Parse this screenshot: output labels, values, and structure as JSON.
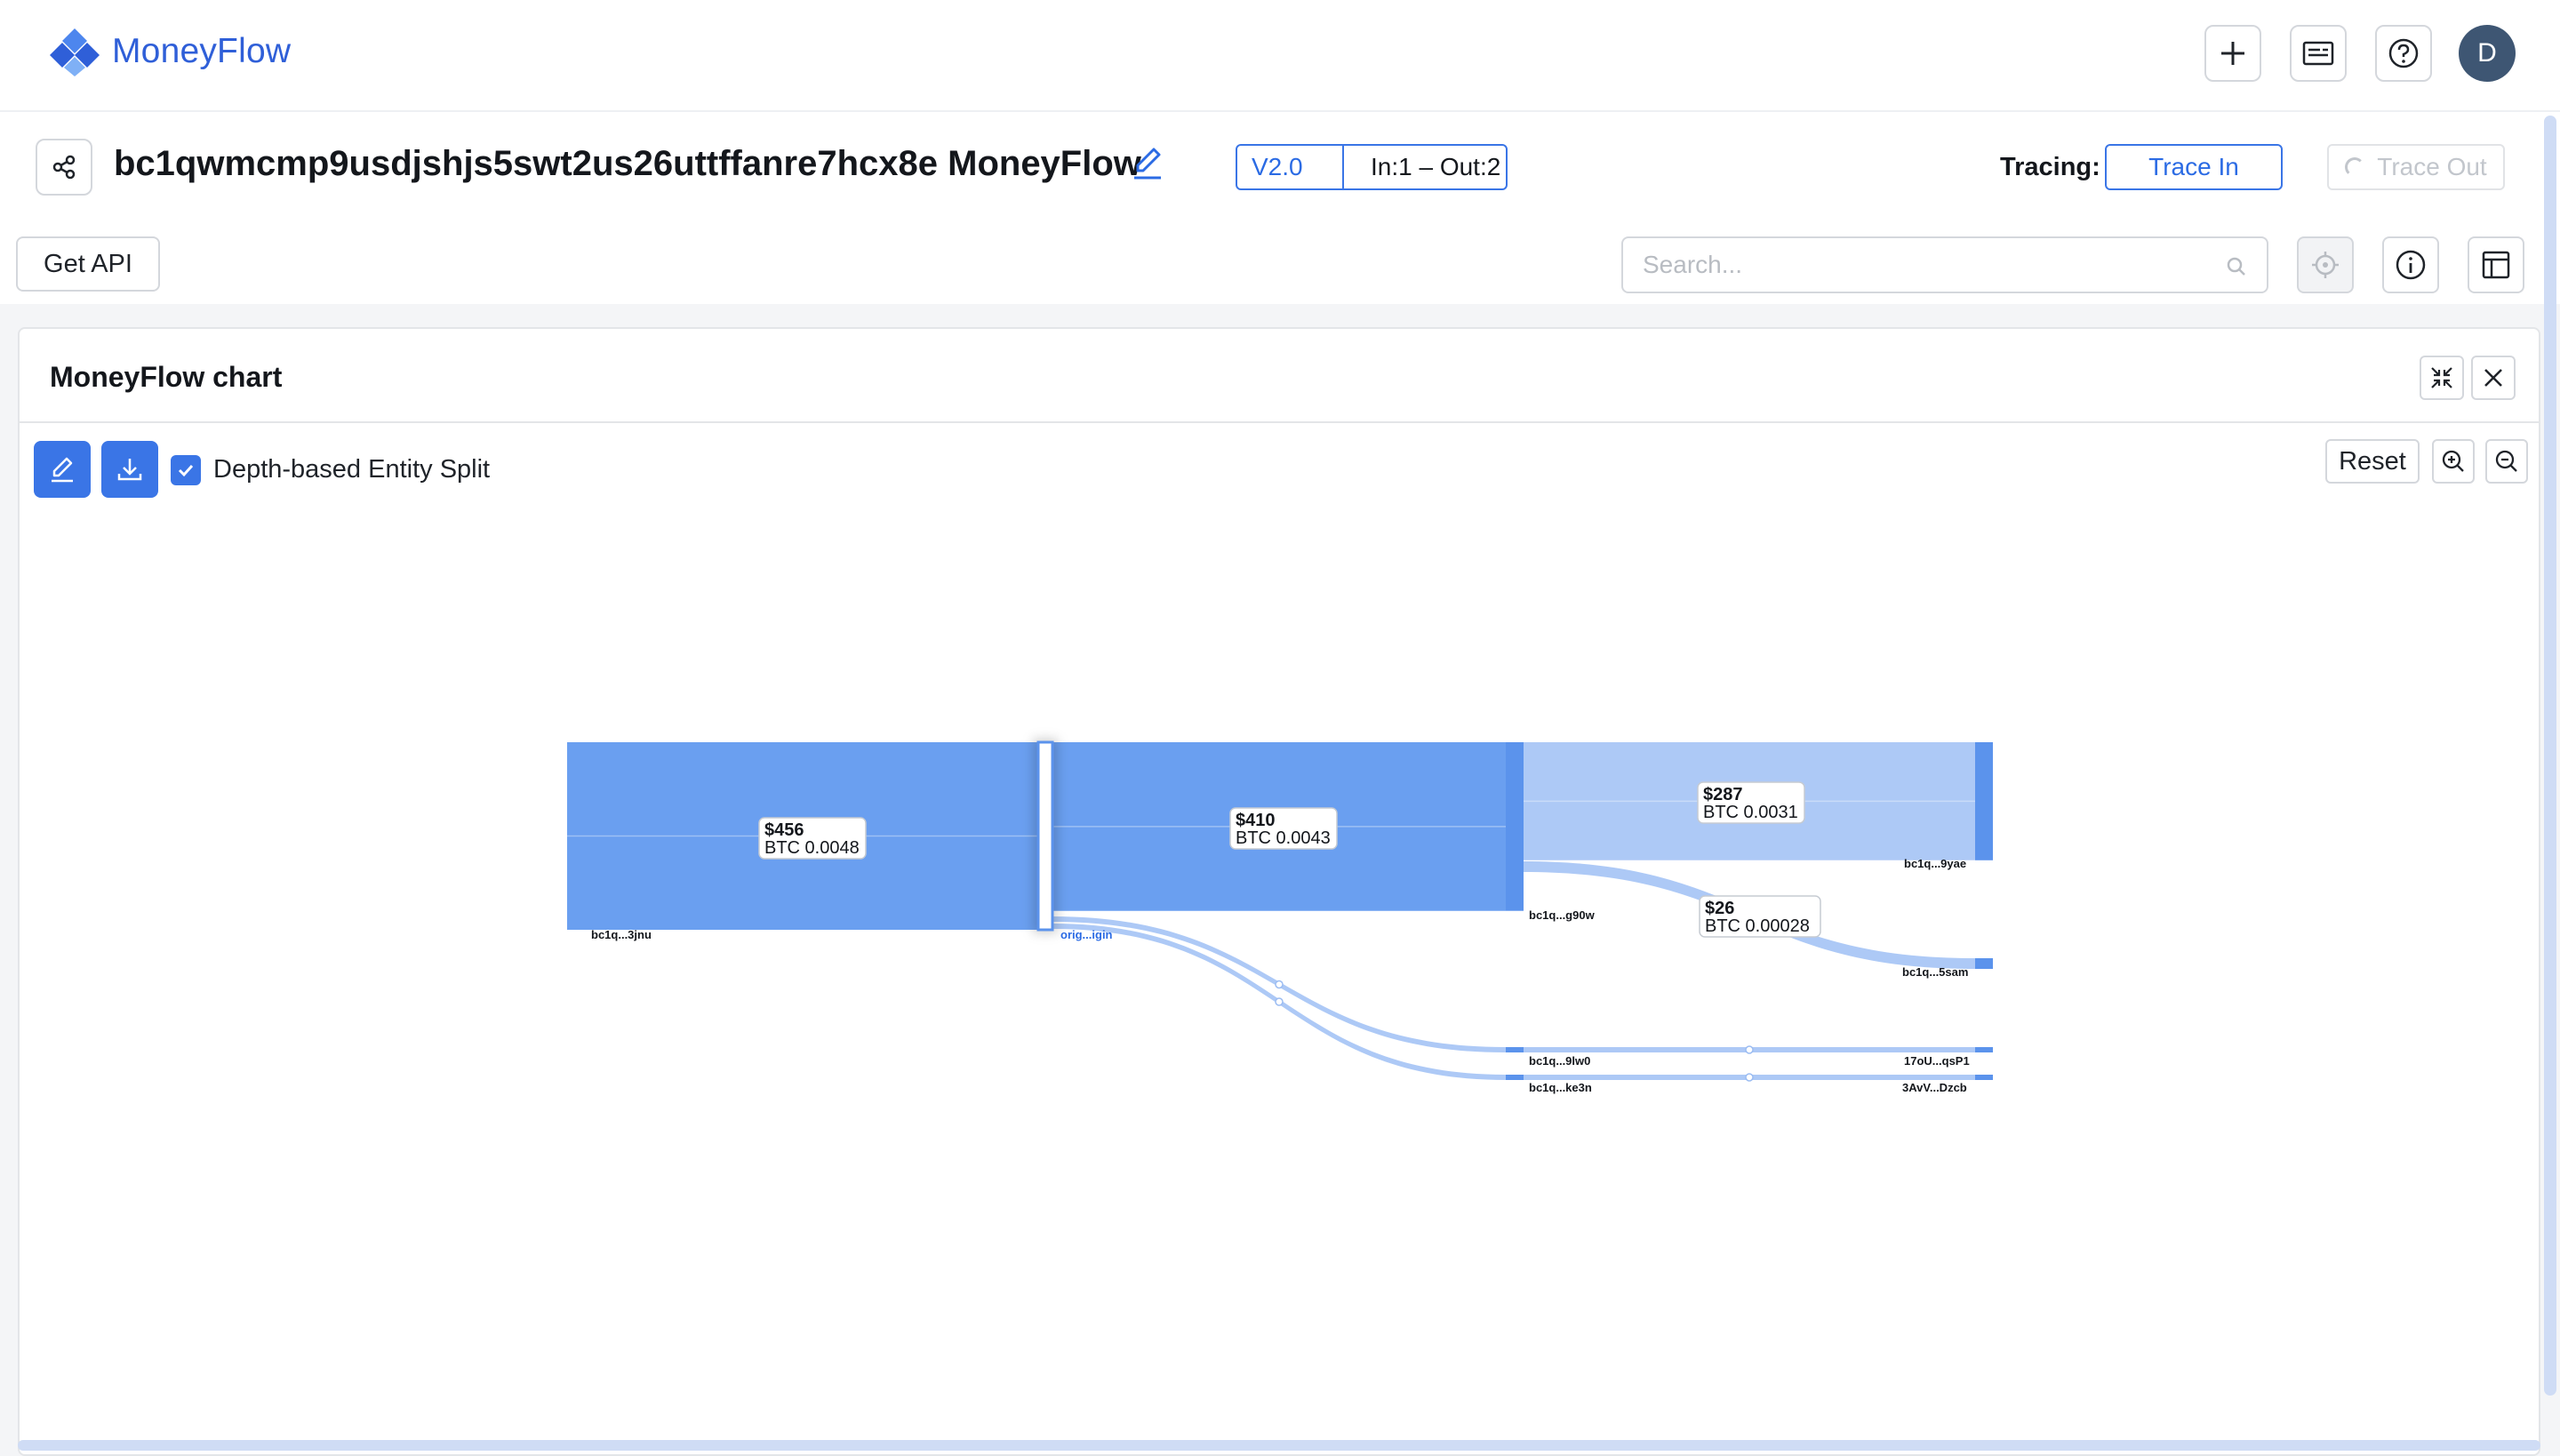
{
  "app": {
    "name": "MoneyFlow",
    "user_initial": "D"
  },
  "header": {
    "title": "bc1qwmcmp9usdjshjs5swt2us26uttffanre7hcx8e MoneyFlow",
    "version": "V2.0",
    "in_out": "In:1 – Out:2",
    "tracing_label": "Tracing:",
    "trace_in_label": "Trace In",
    "trace_out_label": "Trace Out"
  },
  "toolbar": {
    "get_api_label": "Get API",
    "search_placeholder": "Search..."
  },
  "panel": {
    "title": "MoneyFlow chart",
    "checkbox_label": "Depth-based Entity Split",
    "checkbox_checked": true,
    "reset_label": "Reset"
  },
  "chart_data": {
    "type": "sankey",
    "nodes": [
      {
        "id": "bc1q...3jnu",
        "label": "bc1q...3jnu"
      },
      {
        "id": "orig...igin",
        "label": "orig...igin"
      },
      {
        "id": "bc1q...g90w",
        "label": "bc1q...g90w"
      },
      {
        "id": "bc1q...9yae",
        "label": "bc1q...9yae"
      },
      {
        "id": "bc1q...5sam",
        "label": "bc1q...5sam"
      },
      {
        "id": "bc1q...9lw0",
        "label": "bc1q...9lw0"
      },
      {
        "id": "17oU...qsP1",
        "label": "17oU...qsP1"
      },
      {
        "id": "bc1q...ke3n",
        "label": "bc1q...ke3n"
      },
      {
        "id": "3AvV...Dzcb",
        "label": "3AvV...Dzcb"
      }
    ],
    "links": [
      {
        "source": "bc1q...3jnu",
        "target": "orig...igin",
        "usd": "$456",
        "btc": "BTC 0.0048",
        "value": 456
      },
      {
        "source": "orig...igin",
        "target": "bc1q...g90w",
        "usd": "$410",
        "btc": "BTC 0.0043",
        "value": 410
      },
      {
        "source": "bc1q...g90w",
        "target": "bc1q...9yae",
        "usd": "$287",
        "btc": "BTC 0.0031",
        "value": 287
      },
      {
        "source": "bc1q...g90w",
        "target": "bc1q...5sam",
        "usd": "$26",
        "btc": "BTC 0.00028",
        "value": 26
      },
      {
        "source": "orig...igin",
        "target": "bc1q...9lw0",
        "value": 12
      },
      {
        "source": "bc1q...9lw0",
        "target": "17oU...qsP1",
        "value": 12
      },
      {
        "source": "orig...igin",
        "target": "bc1q...ke3n",
        "value": 10
      },
      {
        "source": "bc1q...ke3n",
        "target": "3AvV...Dzcb",
        "value": 10
      }
    ]
  },
  "colors": {
    "accent": "#3a75e6",
    "logo": "#2f5fd8",
    "flow_main": "#6a9ff0",
    "flow_light": "#a4c3f5",
    "node": "#5b93ec"
  }
}
